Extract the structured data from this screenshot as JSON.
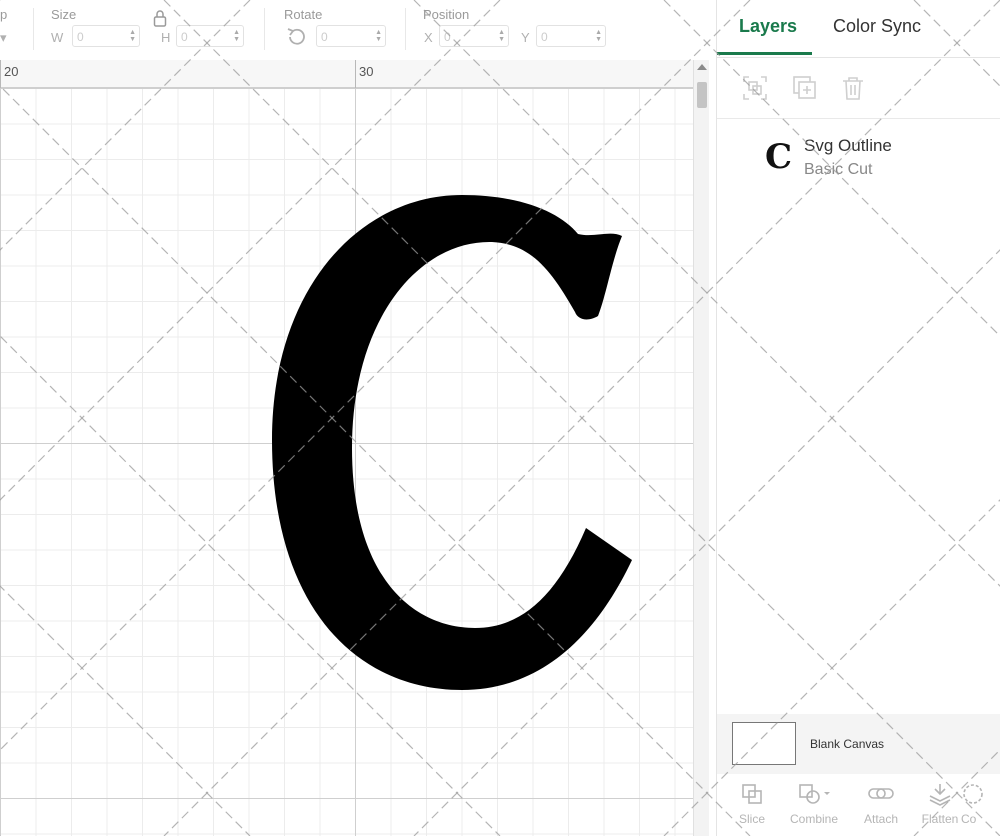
{
  "toolbar": {
    "op_label": "p",
    "size_label": "Size",
    "w_label": "W",
    "w_value": "0",
    "h_label": "H",
    "h_value": "0",
    "rotate_label": "Rotate",
    "rotate_value": "0",
    "position_label": "Position",
    "x_label": "X",
    "x_value": "0",
    "y_label": "Y",
    "y_value": "0"
  },
  "ruler": {
    "marks": [
      "20",
      "30"
    ]
  },
  "canvas": {
    "glyph_color": "#000000"
  },
  "panel": {
    "tabs": [
      {
        "label": "Layers",
        "active": true
      },
      {
        "label": "Color Sync",
        "active": false
      }
    ],
    "accent_color": "#1a7a4c",
    "actions": [
      "group-icon",
      "duplicate-icon",
      "delete-icon"
    ],
    "layers": [
      {
        "name": "Svg Outline",
        "operation": "Basic Cut",
        "thumb": "C"
      }
    ],
    "blank_canvas_label": "Blank Canvas"
  },
  "bottom_toolbar": [
    {
      "label": "Slice",
      "icon": "slice-icon"
    },
    {
      "label": "Combine",
      "icon": "combine-icon"
    },
    {
      "label": "Attach",
      "icon": "attach-icon"
    },
    {
      "label": "Flatten",
      "icon": "flatten-icon"
    },
    {
      "label": "Co",
      "icon": "contour-icon"
    }
  ]
}
